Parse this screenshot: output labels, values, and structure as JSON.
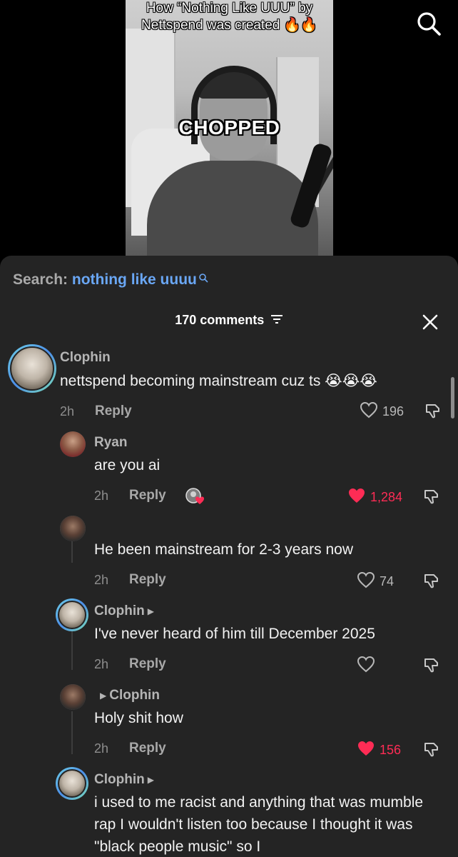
{
  "video": {
    "title": "How “Nothing Like UUU” by Nettspend was created 🔥🔥",
    "caption": "CHOPPED",
    "search_icon": "search-icon"
  },
  "sheet": {
    "search_label": "Search:",
    "search_query": "nothing like uuuu",
    "comment_count": "170 comments",
    "filter_icon": "filter-icon",
    "close_icon": "close-icon"
  },
  "comments": [
    {
      "username": "Clophin",
      "text": "nettspend becoming mainstream cuz ts 😭😭😭",
      "time": "2h",
      "reply_label": "Reply",
      "likes": "196",
      "liked": false
    },
    {
      "username": "Ryan",
      "text": "are you ai",
      "time": "2h",
      "reply_label": "Reply",
      "likes": "1,284",
      "liked": true
    },
    {
      "username": "",
      "text": "He been mainstream for 2-3 years now",
      "time": "2h",
      "reply_label": "Reply",
      "likes": "74",
      "liked": false
    },
    {
      "username": "Clophin",
      "text": "I've never heard of him till December 2025",
      "time": "2h",
      "reply_label": "Reply",
      "likes": "",
      "liked": false
    },
    {
      "username": "Clophin",
      "text": "Holy shit how",
      "time": "2h",
      "reply_label": "Reply",
      "likes": "156",
      "liked": true
    },
    {
      "username": "Clophin",
      "text": "i used to me racist and anything that was mumble rap I wouldn't listen too because I thought it was \"black people music\" so I",
      "time": "",
      "reply_label": "",
      "likes": "",
      "liked": false
    }
  ],
  "colors": {
    "sheet_bg": "#242424",
    "link_blue": "#6aa7f5",
    "like_red": "#fe2c55"
  }
}
